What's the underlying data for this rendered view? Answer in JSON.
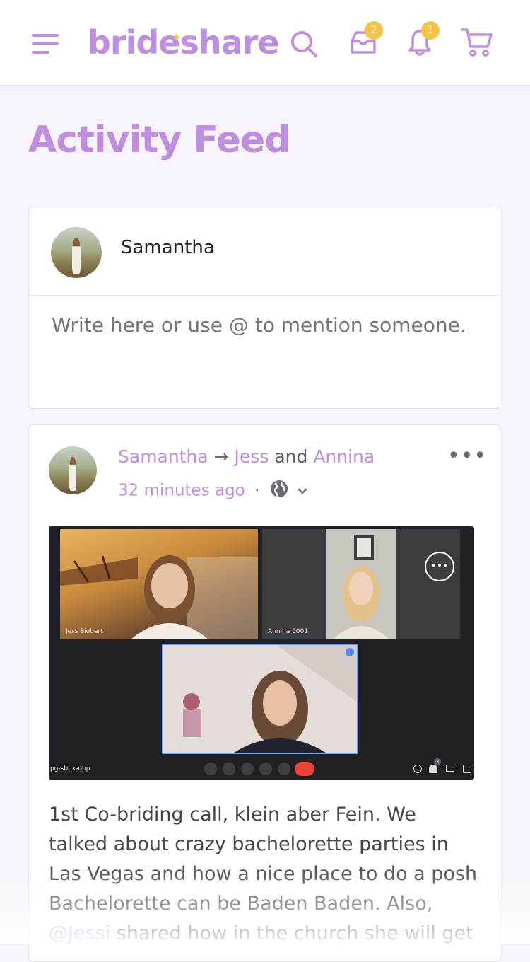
{
  "header": {
    "logo_text": "brideshare",
    "inbox_badge": "2",
    "notifications_badge": "1",
    "accent_color": "#c08ee0",
    "badge_color": "#f5c242"
  },
  "page": {
    "title": "Activity Feed"
  },
  "composer": {
    "author_name": "Samantha",
    "placeholder": "Write here or use @ to mention someone."
  },
  "post": {
    "author": "Samantha",
    "arrow": "→",
    "recipient_1": "Jess",
    "conjunction": "and",
    "recipient_2": "Annina",
    "time": "32 minutes ago",
    "separator": "·",
    "video_call": {
      "tile_1_label": "Jess Siebert",
      "tile_2_label": "Annina 0001",
      "tile_3_label": "You",
      "meeting_code": "pg-sbnx-opp",
      "participants_badge": "3"
    },
    "text_part_1": "1st Co-briding call, klein aber Fein. We talked about crazy bachelorette parties in Las Vegas and how a nice place to do a posh Bachelorette can be Baden Baden. Also, ",
    "mention": "@Jessi",
    "text_part_2": " shared how in the church she will get"
  }
}
